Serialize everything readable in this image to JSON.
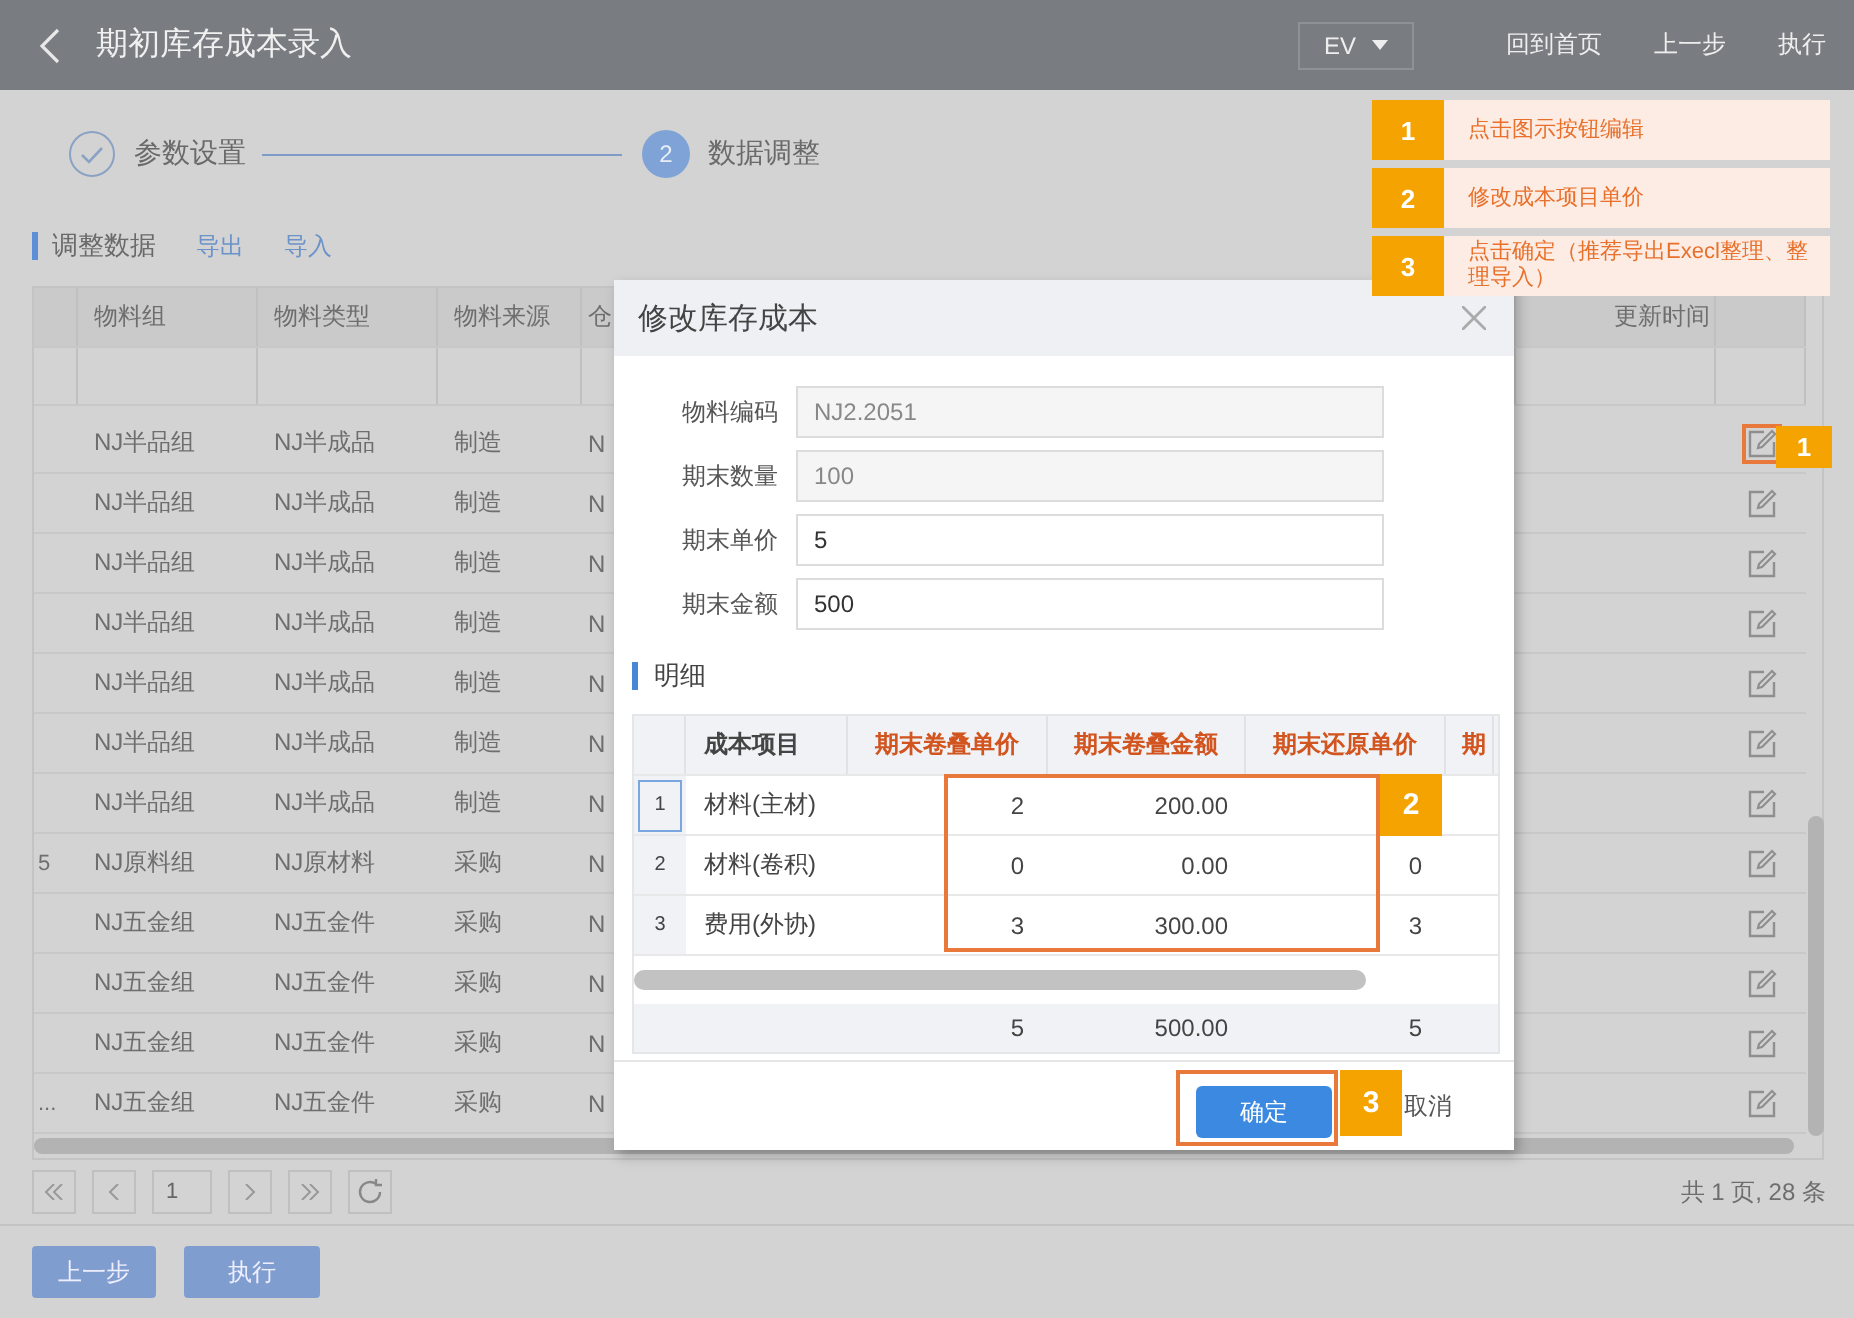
{
  "header": {
    "title": "期初库存成本录入",
    "language": "EV",
    "links": [
      "回到首页",
      "上一步",
      "执行"
    ]
  },
  "steps": [
    {
      "label": "参数设置",
      "completed": true
    },
    {
      "label": "数据调整",
      "number": "2",
      "completed": false
    }
  ],
  "toolbar": {
    "title": "调整数据",
    "actions": [
      "导出",
      "导入"
    ]
  },
  "table": {
    "columns": [
      "物料组",
      "物料类型",
      "物料来源",
      "仓",
      "更新时间"
    ],
    "rows": [
      {
        "cells": [
          "NJ半品组",
          "NJ半成品",
          "制造",
          "N"
        ],
        "callout": "1"
      },
      {
        "cells": [
          "NJ半品组",
          "NJ半成品",
          "制造",
          "N"
        ]
      },
      {
        "cells": [
          "NJ半品组",
          "NJ半成品",
          "制造",
          "N"
        ]
      },
      {
        "cells": [
          "NJ半品组",
          "NJ半成品",
          "制造",
          "N"
        ]
      },
      {
        "cells": [
          "NJ半品组",
          "NJ半成品",
          "制造",
          "N"
        ]
      },
      {
        "cells": [
          "NJ半品组",
          "NJ半成品",
          "制造",
          "N"
        ]
      },
      {
        "cells": [
          "NJ半品组",
          "NJ半成品",
          "制造",
          "N"
        ]
      },
      {
        "index": "5",
        "cells": [
          "NJ原料组",
          "NJ原材料",
          "采购",
          "N"
        ]
      },
      {
        "cells": [
          "NJ五金组",
          "NJ五金件",
          "采购",
          "N"
        ]
      },
      {
        "cells": [
          "NJ五金组",
          "NJ五金件",
          "采购",
          "N"
        ]
      },
      {
        "cells": [
          "NJ五金组",
          "NJ五金件",
          "采购",
          "N"
        ]
      },
      {
        "index": "...",
        "cells": [
          "NJ五金组",
          "NJ五金件",
          "采购",
          "N"
        ]
      }
    ]
  },
  "pagination": {
    "page": "1",
    "summary": "共 1 页, 28 条"
  },
  "footer_buttons": [
    "上一步",
    "执行"
  ],
  "dialog": {
    "title": "修改库存成本",
    "fields": [
      {
        "label": "物料编码",
        "value": "NJ2.2051",
        "disabled": true
      },
      {
        "label": "期末数量",
        "value": "100",
        "disabled": true
      },
      {
        "label": "期末单价",
        "value": "5",
        "disabled": false
      },
      {
        "label": "期末金额",
        "value": "500",
        "disabled": false
      }
    ],
    "section": "明细",
    "grid": {
      "columns": [
        {
          "label": "成本项目",
          "editable": false
        },
        {
          "label": "期末卷叠单价",
          "editable": true
        },
        {
          "label": "期末卷叠金额",
          "editable": true
        },
        {
          "label": "期末还原单价",
          "editable": true
        },
        {
          "label": "期",
          "editable": true
        }
      ],
      "rows": [
        {
          "number": "1",
          "selected": true,
          "cells": [
            "材料(主材)",
            "2",
            "200.00"
          ]
        },
        {
          "number": "2",
          "selected": false,
          "cells": [
            "材料(卷积)",
            "0",
            "0.00",
            "0"
          ]
        },
        {
          "number": "3",
          "selected": false,
          "cells": [
            "费用(外协)",
            "3",
            "300.00",
            "3"
          ]
        }
      ],
      "totals": [
        "5",
        "500.00",
        "5"
      ],
      "callout": "2"
    },
    "buttons": [
      "确定",
      "取消"
    ],
    "confirm_callout": "3"
  },
  "callouts": [
    {
      "number": "1",
      "text": "点击图示按钮编辑"
    },
    {
      "number": "2",
      "text": "修改成本项目单价"
    },
    {
      "number": "3",
      "text": "点击确定（推荐导出Execl整理、整理导入）"
    }
  ]
}
